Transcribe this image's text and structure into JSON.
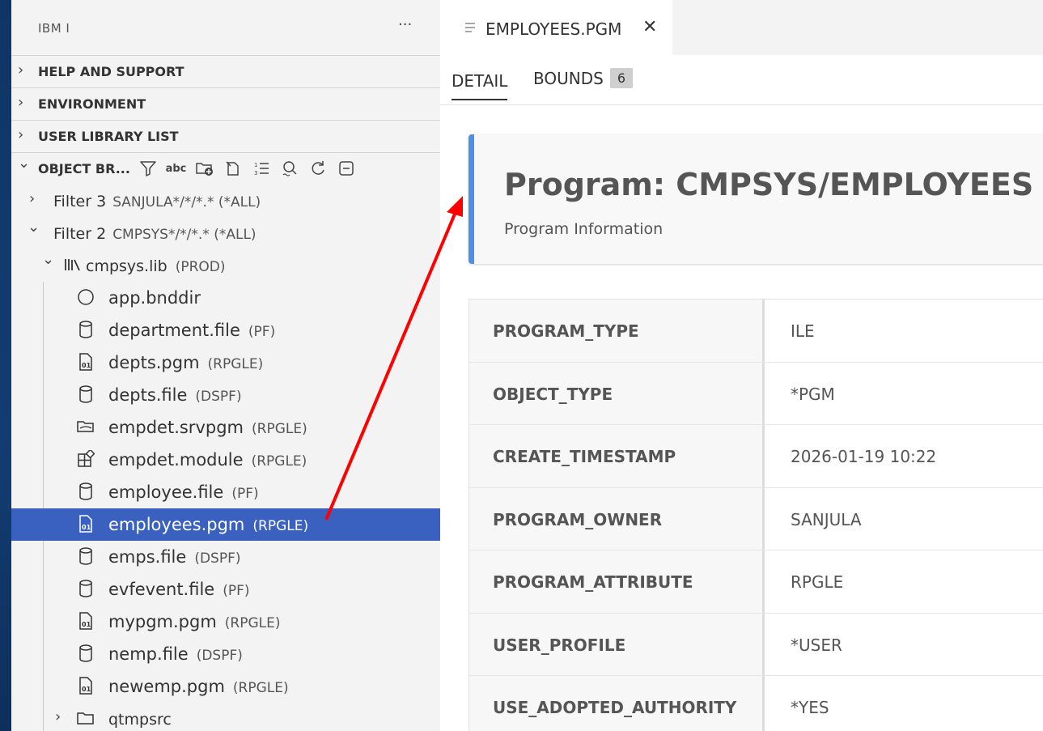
{
  "sidebar": {
    "title": "IBM I",
    "more": "···",
    "sections": [
      {
        "label": "HELP AND SUPPORT",
        "chevron": "›"
      },
      {
        "label": "ENVIRONMENT",
        "chevron": "›"
      },
      {
        "label": "USER LIBRARY LIST",
        "chevron": "›"
      },
      {
        "label": "OBJECT BR...",
        "chevron": "⌄"
      }
    ],
    "toolbar_icons": [
      "filter-icon",
      "abc-icon",
      "new-folder-icon",
      "new-file-icon",
      "sort-list-icon",
      "search-icon",
      "refresh-icon",
      "collapse-all-icon"
    ],
    "toolbar_abc": "abc",
    "filters": [
      {
        "name": "Filter 3",
        "desc": "SANJULA*/*/*.* (*ALL)",
        "expanded": false
      },
      {
        "name": "Filter 2",
        "desc": "CMPSYS*/*/*.* (*ALL)",
        "expanded": true
      }
    ],
    "library": {
      "name": "cmpsys.lib",
      "desc": "(PROD)"
    },
    "objects": [
      {
        "name": "app.bnddir",
        "desc": "",
        "icon": "bnddir-icon"
      },
      {
        "name": "department.file",
        "desc": "(PF)",
        "icon": "file-icon"
      },
      {
        "name": "depts.pgm",
        "desc": "(RPGLE)",
        "icon": "pgm-icon"
      },
      {
        "name": "depts.file",
        "desc": "(DSPF)",
        "icon": "file-icon"
      },
      {
        "name": "empdet.srvpgm",
        "desc": "(RPGLE)",
        "icon": "srvpgm-icon"
      },
      {
        "name": "empdet.module",
        "desc": "(RPGLE)",
        "icon": "module-icon"
      },
      {
        "name": "employee.file",
        "desc": "(PF)",
        "icon": "file-icon"
      },
      {
        "name": "employees.pgm",
        "desc": "(RPGLE)",
        "icon": "pgm-icon",
        "selected": true
      },
      {
        "name": "emps.file",
        "desc": "(DSPF)",
        "icon": "file-icon"
      },
      {
        "name": "evfevent.file",
        "desc": "(PF)",
        "icon": "file-icon"
      },
      {
        "name": "mypgm.pgm",
        "desc": "(RPGLE)",
        "icon": "pgm-icon"
      },
      {
        "name": "nemp.file",
        "desc": "(DSPF)",
        "icon": "file-icon"
      },
      {
        "name": "newemp.pgm",
        "desc": "(RPGLE)",
        "icon": "pgm-icon"
      }
    ],
    "subfolder": {
      "name": "qtmpsrc",
      "desc": ""
    }
  },
  "editor": {
    "tab": {
      "name": "EMPLOYEES.PGM",
      "close": "✕"
    },
    "subtabs": {
      "detail": "DETAIL",
      "bounds": "BOUNDS",
      "bounds_count": "6"
    },
    "header": {
      "title": "Program: CMPSYS/EMPLOYEES",
      "subtitle": "Program Information"
    },
    "rows": [
      {
        "key": "PROGRAM_TYPE",
        "value": "ILE"
      },
      {
        "key": "OBJECT_TYPE",
        "value": "*PGM"
      },
      {
        "key": "CREATE_TIMESTAMP",
        "value": "2026-01-19 10:22"
      },
      {
        "key": "PROGRAM_OWNER",
        "value": "SANJULA"
      },
      {
        "key": "PROGRAM_ATTRIBUTE",
        "value": "RPGLE"
      },
      {
        "key": "USER_PROFILE",
        "value": "*USER"
      },
      {
        "key": "USE_ADOPTED_AUTHORITY",
        "value": "*YES"
      }
    ]
  },
  "colors": {
    "accent": "#4f8fe6",
    "selection": "#3a60c0",
    "annotation_arrow": "#ff0000"
  }
}
